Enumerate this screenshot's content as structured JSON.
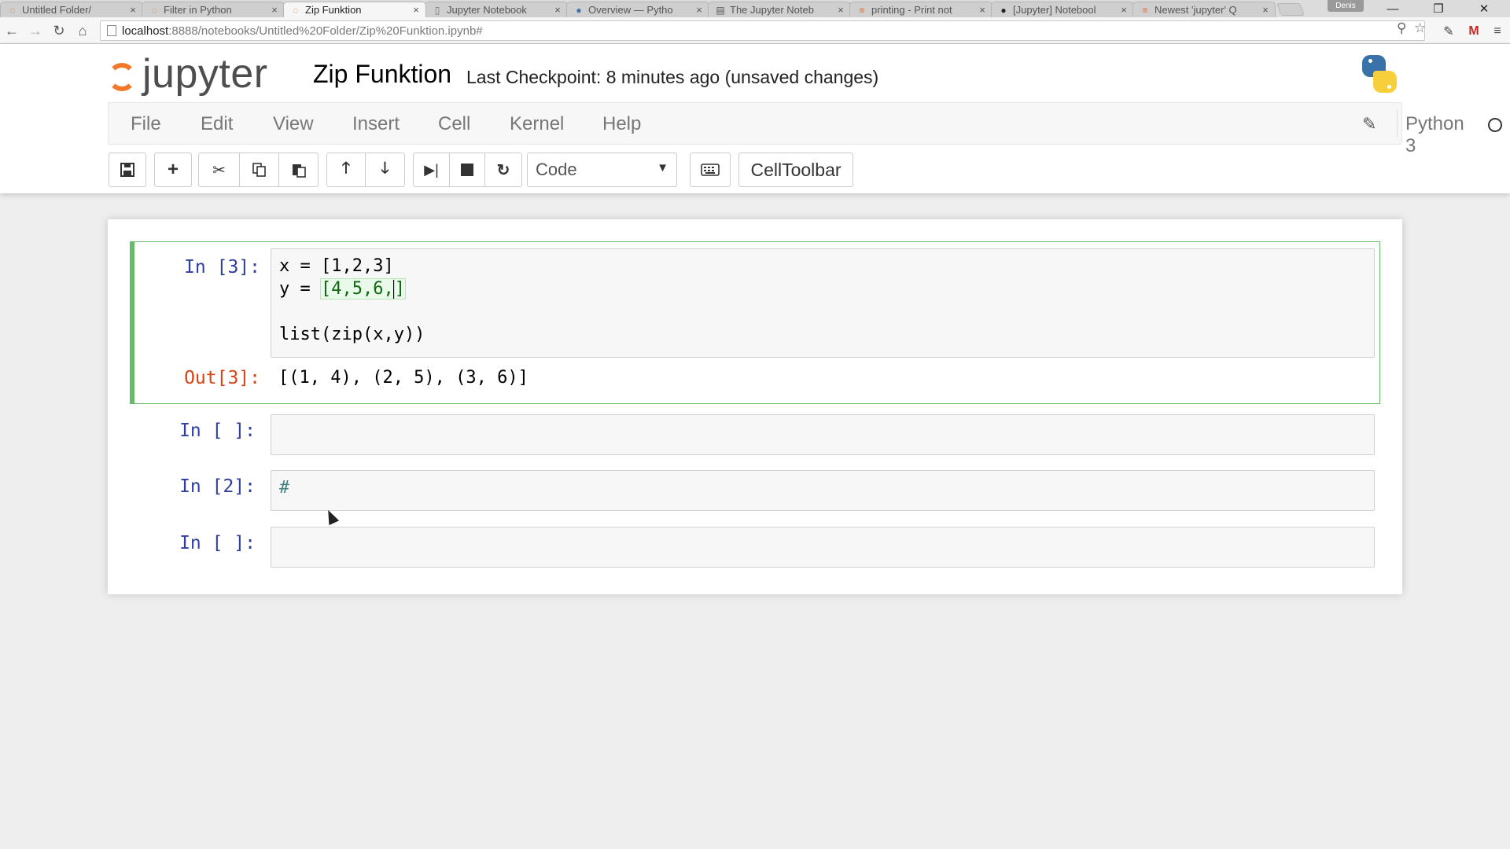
{
  "browser": {
    "tabs": [
      {
        "title": "Untitled Folder/",
        "icon": "jupyter-icon",
        "active": false
      },
      {
        "title": "Filter in Python",
        "icon": "jupyter-icon",
        "active": false
      },
      {
        "title": "Zip Funktion",
        "icon": "jupyter-icon",
        "active": true
      },
      {
        "title": "Jupyter Notebook",
        "icon": "document-icon",
        "active": false
      },
      {
        "title": "Overview — Pytho",
        "icon": "python-icon",
        "active": false
      },
      {
        "title": "The Jupyter Noteb",
        "icon": "book-icon",
        "active": false
      },
      {
        "title": "printing - Print not",
        "icon": "stackoverflow-icon",
        "active": false
      },
      {
        "title": "[Jupyter] Notebool",
        "icon": "github-icon",
        "active": false
      },
      {
        "title": "Newest 'jupyter' Q",
        "icon": "stackoverflow-icon",
        "active": false
      }
    ],
    "profile_label": "Denis",
    "url_host": "localhost",
    "url_path": ":8888/notebooks/Untitled%20Folder/Zip%20Funktion.ipynb#"
  },
  "jupyter": {
    "logo_text": "jupyter",
    "notebook_title": "Zip Funktion",
    "checkpoint": "Last Checkpoint: 8 minutes ago (unsaved changes)",
    "menu": [
      "File",
      "Edit",
      "View",
      "Insert",
      "Cell",
      "Kernel",
      "Help"
    ],
    "kernel_name": "Python 3",
    "cell_type": "Code",
    "celltoolbar_label": "CellToolbar"
  },
  "cells": [
    {
      "prompt": "In [3]:",
      "code_line1": "x = [1,2,3]",
      "code_line2_prefix": "y = ",
      "code_line2_rest": "[4,5,6,",
      "code_line2_close": "]",
      "code_line4": "list(zip(x,y))",
      "out_prompt": "Out[3]:",
      "output": "[(1, 4), (2, 5), (3, 6)]"
    },
    {
      "prompt": "In [ ]:",
      "code": ""
    },
    {
      "prompt": "In [2]:",
      "code": "#"
    },
    {
      "prompt": "In [ ]:",
      "code": ""
    }
  ],
  "colors": {
    "jupyter_orange": "#f37726",
    "selected_cell_border": "#66bb6a",
    "in_prompt": "#303f9f",
    "out_prompt": "#d84315"
  }
}
